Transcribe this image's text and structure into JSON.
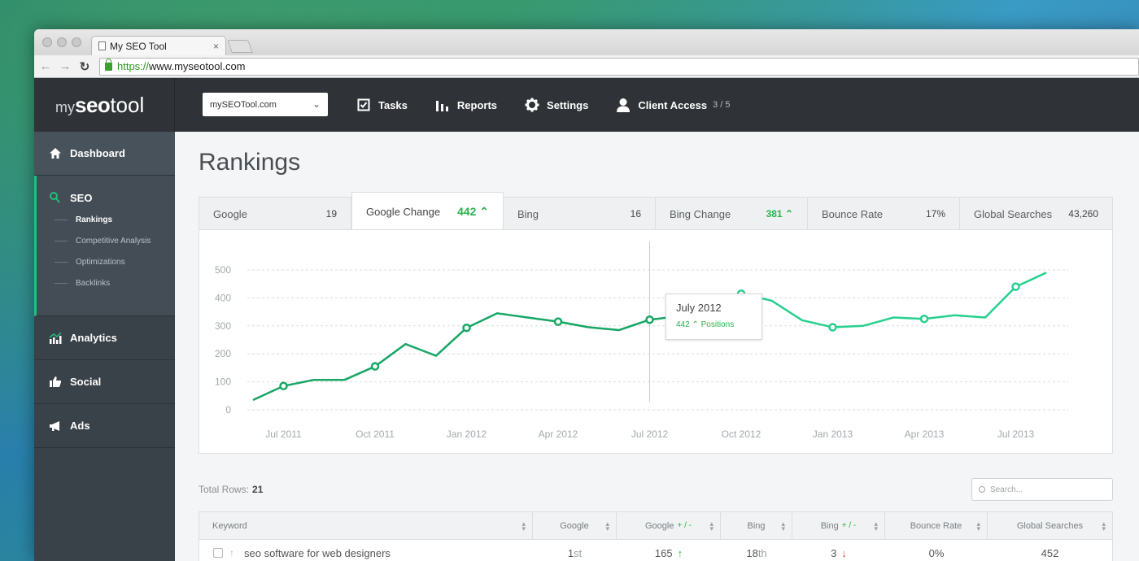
{
  "browser": {
    "tab_title": "My SEO Tool",
    "url_scheme": "https://",
    "url_rest": "www.myseotool.com"
  },
  "header": {
    "logo_my": "my",
    "logo_seo": "seo",
    "logo_tool": "tool",
    "site_select": "mySEOTool.com",
    "nav": [
      {
        "label": "Tasks",
        "icon": "checkbox-icon"
      },
      {
        "label": "Reports",
        "icon": "bar-chart-icon"
      },
      {
        "label": "Settings",
        "icon": "gear-icon"
      },
      {
        "label": "Client Access",
        "icon": "user-icon",
        "count": "3 / 5"
      }
    ]
  },
  "sidebar": {
    "dashboard": "Dashboard",
    "seo": "SEO",
    "seo_sub": [
      "Rankings",
      "Competitive Analysis",
      "Optimizations",
      "Backlinks"
    ],
    "analytics": "Analytics",
    "social": "Social",
    "ads": "Ads"
  },
  "main": {
    "title": "Rankings",
    "metric_tabs": [
      {
        "label": "Google",
        "value": "19"
      },
      {
        "label": "Google Change",
        "value": "442",
        "trend": "up"
      },
      {
        "label": "Bing",
        "value": "16"
      },
      {
        "label": "Bing Change",
        "value": "381",
        "trend": "up"
      },
      {
        "label": "Bounce Rate",
        "value": "17%"
      },
      {
        "label": "Global Searches",
        "value": "43,260"
      }
    ],
    "tooltip": {
      "title": "July 2012",
      "value": "442",
      "unit": "Positions"
    },
    "total_rows_label": "Total Rows:",
    "total_rows_value": "21",
    "search_placeholder": "Search...",
    "table": {
      "columns": [
        "Keyword",
        "Google",
        "Google",
        "Bing",
        "Bing",
        "Bounce Rate",
        "Global Searches"
      ],
      "plus_minus": "+ / -",
      "rows": [
        {
          "keyword": "seo software for web designers",
          "google": "1",
          "google_sfx": "st",
          "google_change": "165",
          "bing": "18",
          "bing_sfx": "th",
          "bing_change": "3",
          "bounce": "0%",
          "searches": "452"
        }
      ]
    }
  },
  "colors": {
    "accent": "#1fbf7c",
    "line": "#1aa86a",
    "up": "#2bb34a",
    "down": "#e0413a"
  },
  "chart_data": {
    "type": "line",
    "x": [
      "Jun 2011",
      "Jul 2011",
      "Aug 2011",
      "Sep 2011",
      "Oct 2011",
      "Nov 2011",
      "Dec 2011",
      "Jan 2012",
      "Feb 2012",
      "Mar 2012",
      "Apr 2012",
      "May 2012",
      "Jun 2012",
      "Jul 2012",
      "Aug 2012",
      "Sep 2012",
      "Oct 2012",
      "Nov 2012",
      "Dec 2012",
      "Jan 2013",
      "Feb 2013",
      "Mar 2013",
      "Apr 2013",
      "May 2013",
      "Jun 2013",
      "Jul 2013",
      "Aug 2013"
    ],
    "series": [
      {
        "values": [
          35,
          85,
          107,
          107,
          155,
          235,
          193,
          293,
          345,
          330,
          315,
          295,
          285,
          322,
          335,
          350,
          415,
          390,
          320,
          295,
          300,
          330,
          325,
          338,
          330,
          440,
          490
        ]
      }
    ],
    "markers": [
      1,
      4,
      7,
      10,
      13,
      16,
      19,
      22,
      25
    ],
    "x_tick_labels": [
      "Jul 2011",
      "Oct 2011",
      "Jan 2012",
      "Apr 2012",
      "Jul 2012",
      "Oct 2012",
      "Jan 2013",
      "Apr 2013",
      "Jul 2013"
    ],
    "y_ticks": [
      0,
      100,
      200,
      300,
      400,
      500
    ],
    "ylim": [
      0,
      500
    ],
    "hover_index": 13,
    "grid": true
  }
}
